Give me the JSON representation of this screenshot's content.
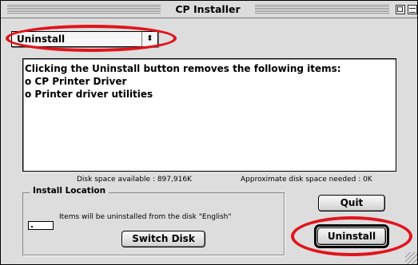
{
  "window": {
    "title": "CP Installer"
  },
  "popup": {
    "selected": "Uninstall",
    "arrow": "⬍"
  },
  "info": {
    "lines": [
      "Clicking the Uninstall button removes the following items:",
      "o CP Printer Driver",
      "o Printer driver utilities"
    ]
  },
  "disk": {
    "available": "Disk space available : 897,916K",
    "needed": "Approximate disk space needed : 0K"
  },
  "location": {
    "legend": "Install Location",
    "message": "Items will be uninstalled from the disk \"English\"",
    "switch_label": "Switch Disk"
  },
  "buttons": {
    "quit": "Quit",
    "uninstall": "Uninstall"
  },
  "colors": {
    "highlight_oval": "#e0141c",
    "window_bg": "#dddddd"
  }
}
